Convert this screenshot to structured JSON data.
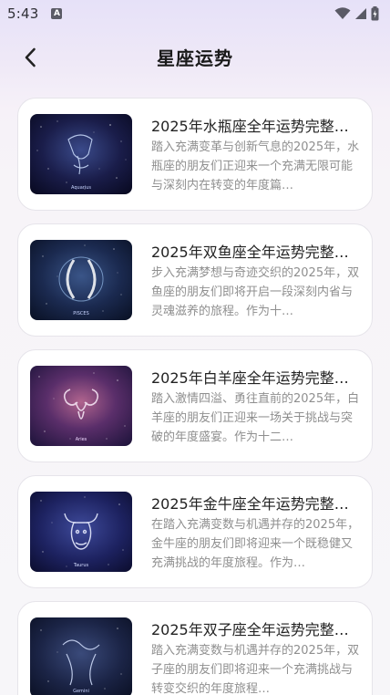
{
  "status_bar": {
    "time": "5:43",
    "notification_icon": "a-notification-icon",
    "icons": [
      "wifi-icon",
      "signal-icon",
      "battery-icon"
    ]
  },
  "header": {
    "title": "星座运势",
    "back_icon": "chevron-left-icon"
  },
  "articles": [
    {
      "title": "2025年水瓶座全年运势完整…",
      "description": "踏入充满变革与创新气息的2025年，水瓶座的朋友们正迎来一个充满无限可能与深刻内在转变的年度篇…",
      "image_label": "aquarius-image",
      "image_caption": "Aquarius"
    },
    {
      "title": "2025年双鱼座全年运势完整…",
      "description": "步入充满梦想与奇迹交织的2025年，双鱼座的朋友们即将开启一段深刻内省与灵魂滋养的旅程。作为十…",
      "image_label": "pisces-image",
      "image_caption": "PISCES"
    },
    {
      "title": "2025年白羊座全年运势完整…",
      "description": "踏入激情四溢、勇往直前的2025年，白羊座的朋友们正迎来一场关于挑战与突破的年度盛宴。作为十二…",
      "image_label": "aries-image",
      "image_caption": "Aries"
    },
    {
      "title": "2025年金牛座全年运势完整…",
      "description": "在踏入充满变数与机遇并存的2025年，金牛座的朋友们即将迎来一个既稳健又充满挑战的年度旅程。作为…",
      "image_label": "taurus-image",
      "image_caption": "Taurus"
    },
    {
      "title": "2025年双子座全年运势完整…",
      "description": "踏入充满变数与机遇并存的2025年，双子座的朋友们即将迎来一个充满挑战与转变交织的年度旅程…",
      "image_label": "gemini-image",
      "image_caption": "Gemini"
    }
  ],
  "colors": {
    "card_bg": "#ffffff",
    "title_text": "#222222",
    "desc_text": "#8f8f8f",
    "page_bg_top": "#e6e1f8"
  }
}
